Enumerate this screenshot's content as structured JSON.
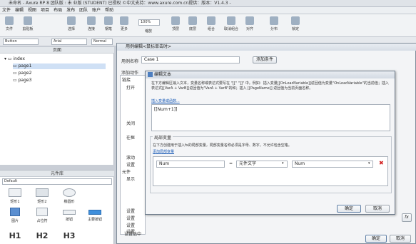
{
  "window": {
    "title": "未命名 - Axure RP 8 团队版 : 未 业版 (STUDENT) 已授权   ©中文支持：www.axure.com.cn提供：版本：V1.4.3 -"
  },
  "menu": [
    "文件",
    "编辑",
    "视图",
    "项目",
    "布局",
    "发布",
    "团队",
    "账户",
    "帮助"
  ],
  "toolbar": {
    "items": [
      "文件",
      "剪贴板",
      "选择",
      "连接",
      "钢笔",
      "更多",
      "缩放",
      "顶层",
      "底层",
      "组合",
      "取消组合",
      "对齐",
      "分布",
      "锁定"
    ],
    "zoom": "100%"
  },
  "format": {
    "widget": "Button",
    "font": "Arial",
    "style": "Normal"
  },
  "pages": {
    "header": "页面",
    "root": "index",
    "items": [
      "page1",
      "page2",
      "page3"
    ]
  },
  "library": {
    "header": "元件库",
    "selected": "Default",
    "items": [
      "矩形1",
      "矩形2",
      "椭圆形",
      "图片",
      "占位符",
      "按钮",
      "主要按钮",
      "H1",
      "H2",
      "H3"
    ]
  },
  "case_editor": {
    "title": "用例编辑<鼠标单击时>",
    "case_name_label": "用例名称",
    "case_name": "Case 1",
    "add_condition": "添加条件",
    "add_action_label": "添加动作",
    "tree": [
      "链接",
      "打开",
      "关闭",
      "在框",
      "滚动",
      "设置",
      "元件",
      "显示",
      "设置",
      "设置",
      "设置",
      "设置",
      "设置选中"
    ],
    "ok": "确定",
    "cancel": "取消",
    "fx": "fx"
  },
  "text_editor": {
    "title": "编辑文本",
    "instructions": "在下方编辑区输入文本，变量名称或表达式要写在 \"[[\" \"]]\" 中。例如：插入变量[[OnLoadVariable]]返回值为变量\"OnLoadVariable\"的当前值；插入表达式[[VarA + VarB]]返回值为\"VarA + VarB\"的和；插入 [[PageName]] 返回值为当前页面名称。",
    "insert_link": "插入变量或函数...",
    "content": "[[Num+1]]",
    "local_vars_title": "局部变量",
    "local_vars_desc": "在下方创建用于插入fx的局部变量，局部变量名称必须是字母、数字，不允许包含空格。",
    "add_local_var": "添加局部变量",
    "var_row": {
      "name": "Num",
      "equals": "=",
      "type": "元件文字",
      "target": "Num"
    },
    "ok": "确定",
    "cancel": "取消"
  }
}
